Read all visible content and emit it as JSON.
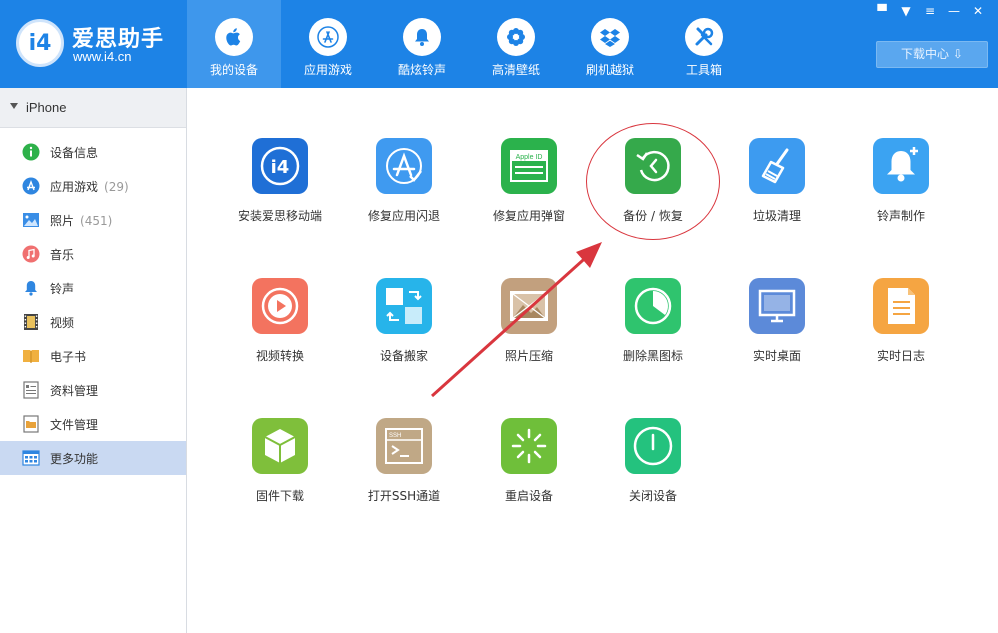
{
  "app": {
    "title": "爱思助手",
    "url": "www.i4.cn",
    "badge": "i4"
  },
  "nav": {
    "tabs": [
      {
        "label": "我的设备",
        "icon": "apple-icon",
        "active": true
      },
      {
        "label": "应用游戏",
        "icon": "app-store-icon",
        "active": false
      },
      {
        "label": "酷炫铃声",
        "icon": "bell-icon",
        "active": false
      },
      {
        "label": "高清壁纸",
        "icon": "flower-icon",
        "active": false
      },
      {
        "label": "刷机越狱",
        "icon": "dropbox-icon",
        "active": false
      },
      {
        "label": "工具箱",
        "icon": "tools-icon",
        "active": false
      }
    ],
    "download_center": "下载中心"
  },
  "sidebar": {
    "device": "iPhone",
    "items": [
      {
        "label": "设备信息",
        "count": "",
        "icon": "info-icon",
        "color": "#2eb14a"
      },
      {
        "label": "应用游戏",
        "count": "(29)",
        "icon": "app-icon",
        "color": "#2f86e0"
      },
      {
        "label": "照片",
        "count": "(451)",
        "icon": "photo-icon",
        "color": "#3a8ee6"
      },
      {
        "label": "音乐",
        "count": "",
        "icon": "music-icon",
        "color": "#f07070"
      },
      {
        "label": "铃声",
        "count": "",
        "icon": "bell-icon",
        "color": "#2f86e0"
      },
      {
        "label": "视频",
        "count": "",
        "icon": "video-icon",
        "color": "#555555"
      },
      {
        "label": "电子书",
        "count": "",
        "icon": "book-icon",
        "color": "#f0b040"
      },
      {
        "label": "资料管理",
        "count": "",
        "icon": "contacts-icon",
        "color": "#666666"
      },
      {
        "label": "文件管理",
        "count": "",
        "icon": "folder-icon",
        "color": "#e8a23a"
      },
      {
        "label": "更多功能",
        "count": "",
        "icon": "grid-icon",
        "color": "#2f86e0",
        "active": true
      }
    ]
  },
  "tools": [
    {
      "label": "安装爱思移动端",
      "icon": "i4-app-icon",
      "color": "#1f6fd6"
    },
    {
      "label": "修复应用闪退",
      "icon": "app-repair-icon",
      "color": "#3f9af0"
    },
    {
      "label": "修复应用弹窗",
      "icon": "apple-id-icon",
      "color": "#2bb24c",
      "text": "Apple ID"
    },
    {
      "label": "备份 / 恢复",
      "icon": "backup-restore-icon",
      "color": "#35a94b"
    },
    {
      "label": "垃圾清理",
      "icon": "broom-icon",
      "color": "#3d9bf0"
    },
    {
      "label": "铃声制作",
      "icon": "bell-plus-icon",
      "color": "#3ba3f2"
    },
    {
      "label": "视频转换",
      "icon": "play-icon",
      "color": "#f3735f"
    },
    {
      "label": "设备搬家",
      "icon": "transfer-icon",
      "color": "#27b4ea"
    },
    {
      "label": "照片压缩",
      "icon": "image-icon",
      "color": "#c2a07e"
    },
    {
      "label": "删除黑图标",
      "icon": "pie-icon",
      "color": "#2fc46e"
    },
    {
      "label": "实时桌面",
      "icon": "monitor-icon",
      "color": "#5c8ad9"
    },
    {
      "label": "实时日志",
      "icon": "document-icon",
      "color": "#f5a542"
    },
    {
      "label": "固件下载",
      "icon": "cube-icon",
      "color": "#7fbf3b"
    },
    {
      "label": "打开SSH通道",
      "icon": "terminal-icon",
      "color": "#c0a886",
      "text": "SSH"
    },
    {
      "label": "重启设备",
      "icon": "restart-icon",
      "color": "#6fbf3a"
    },
    {
      "label": "关闭设备",
      "icon": "power-icon",
      "color": "#24c27e"
    }
  ],
  "annotation_color": "#d9363e"
}
